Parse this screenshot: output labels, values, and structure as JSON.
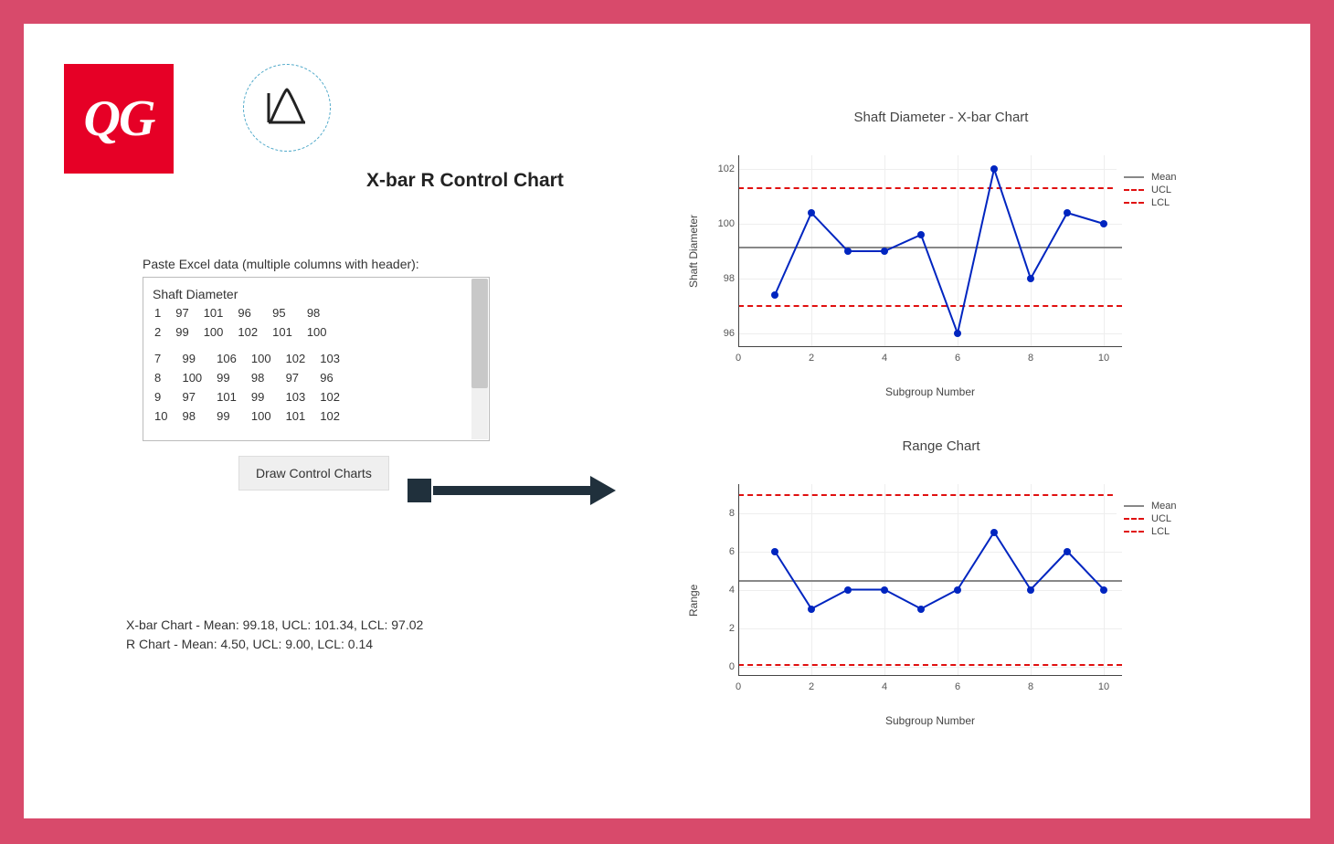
{
  "logo_text": "QG",
  "title": "X-bar R Control Chart",
  "input": {
    "label": "Paste Excel data (multiple columns with header):",
    "header": "Shaft Diameter",
    "rows_top": [
      [
        "1",
        "97",
        "101",
        "96",
        "95",
        "98"
      ],
      [
        "2",
        "99",
        "100",
        "102",
        "101",
        "100"
      ]
    ],
    "rows_bottom": [
      [
        "7",
        "99",
        "106",
        "100",
        "102",
        "103"
      ],
      [
        "8",
        "100",
        "99",
        "98",
        "97",
        "96"
      ],
      [
        "9",
        "97",
        "101",
        "99",
        "103",
        "102"
      ],
      [
        "10",
        "98",
        "99",
        "100",
        "101",
        "102"
      ]
    ],
    "button": "Draw Control Charts"
  },
  "summary": {
    "line1": "X-bar Chart - Mean: 99.18, UCL: 101.34, LCL: 97.02",
    "line2": "R Chart - Mean: 4.50, UCL: 9.00, LCL: 0.14"
  },
  "legend": {
    "mean": "Mean",
    "ucl": "UCL",
    "lcl": "LCL"
  },
  "chart_data": [
    {
      "type": "line",
      "title": "Shaft Diameter - X-bar Chart",
      "xlabel": "Subgroup Number",
      "ylabel": "Shaft Diameter",
      "x": [
        1,
        2,
        3,
        4,
        5,
        6,
        7,
        8,
        9,
        10
      ],
      "values": [
        97.4,
        100.4,
        99.0,
        99.0,
        99.6,
        96.0,
        102.0,
        98.0,
        100.4,
        100.0
      ],
      "mean": 99.18,
      "ucl": 101.34,
      "lcl": 97.02,
      "ylim": [
        95.5,
        102.5
      ],
      "yticks": [
        96,
        98,
        100,
        102
      ],
      "xlim": [
        0,
        10.5
      ],
      "xticks": [
        0,
        2,
        4,
        6,
        8,
        10
      ]
    },
    {
      "type": "line",
      "title": "Range Chart",
      "xlabel": "Subgroup Number",
      "ylabel": "Range",
      "x": [
        1,
        2,
        3,
        4,
        5,
        6,
        7,
        8,
        9,
        10
      ],
      "values": [
        6,
        3,
        4,
        4,
        3,
        4,
        7,
        4,
        6,
        4
      ],
      "mean": 4.5,
      "ucl": 9.0,
      "lcl": 0.14,
      "ylim": [
        -0.5,
        9.5
      ],
      "yticks": [
        0,
        2,
        4,
        6,
        8
      ],
      "xlim": [
        0,
        10.5
      ],
      "xticks": [
        0,
        2,
        4,
        6,
        8,
        10
      ]
    }
  ]
}
